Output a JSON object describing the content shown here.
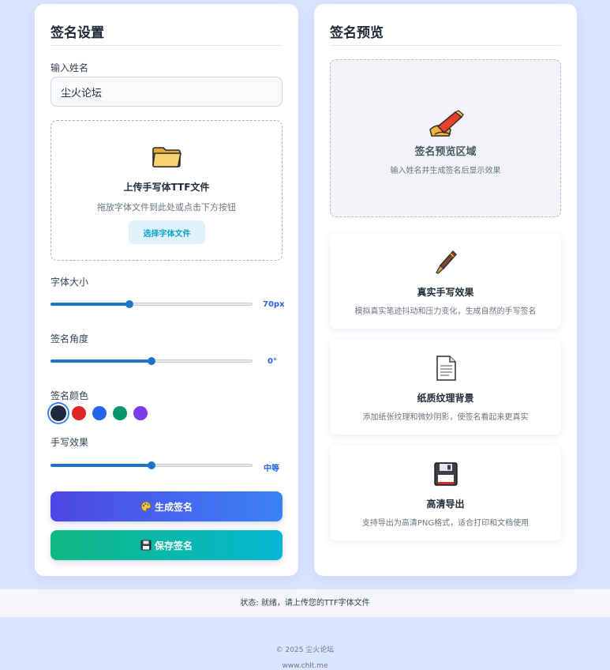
{
  "settings": {
    "title": "签名设置",
    "name_label": "输入姓名",
    "name_value": "尘火论坛",
    "upload": {
      "title": "上传手写体TTF文件",
      "description": "拖放字体文件到此处或点击下方按钮",
      "button_label": "选择字体文件",
      "icon": "folder-icon"
    },
    "font_size": {
      "label": "字体大小",
      "value_text": "70px",
      "fraction": 0.39
    },
    "angle": {
      "label": "签名角度",
      "value_text": "0°",
      "fraction": 0.5
    },
    "color": {
      "label": "签名颜色",
      "options": [
        "#1e293b",
        "#dc2626",
        "#2563eb",
        "#059669",
        "#7c3aed"
      ],
      "selected_index": 0
    },
    "effect": {
      "label": "手写效果",
      "value_text": "中等",
      "fraction": 0.5
    },
    "generate_button": "生成签名",
    "save_button": "保存签名"
  },
  "preview": {
    "title": "签名预览",
    "area_title": "签名预览区域",
    "area_desc": "输入姓名并生成签名后显示效果",
    "icon": "signing-pen-icon"
  },
  "features": [
    {
      "icon": "fountain-pen-icon",
      "title": "真实手写效果",
      "desc": "模拟真实笔迹抖动和压力变化，生成自然的手写签名"
    },
    {
      "icon": "document-icon",
      "title": "纸质纹理背景",
      "desc": "添加纸张纹理和微妙阴影，使签名看起来更真实"
    },
    {
      "icon": "floppy-disk-icon",
      "title": "高清导出",
      "desc": "支持导出为高清PNG格式，适合打印和文档使用"
    }
  ],
  "status": "状态: 就绪，请上传您的TTF字体文件",
  "footer": {
    "copyright": "© 2025 尘火论坛",
    "url": "www.chlt.me"
  },
  "colors": {
    "accent": "#1e74c9",
    "generate_gradient": [
      "#4f46e5",
      "#3b82f6"
    ],
    "save_gradient": [
      "#10b981",
      "#06b6d4"
    ]
  }
}
